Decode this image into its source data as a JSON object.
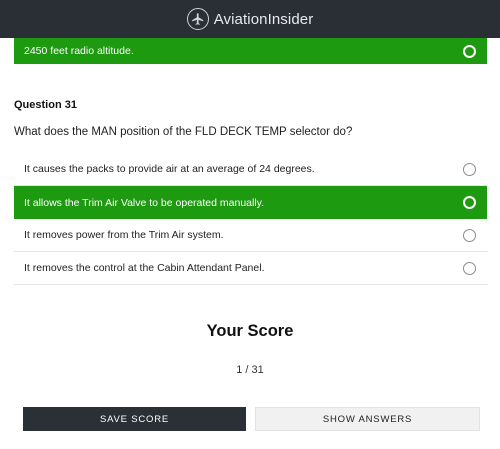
{
  "header": {
    "brand": "AviationInsider",
    "logo_icon": "airplane-icon",
    "background": "#2a2e35"
  },
  "previous_answer": {
    "text": "2450 feet radio altitude.",
    "selected": true
  },
  "question": {
    "number_label": "Question 31",
    "text": "What does the MAN position of the FLD DECK TEMP selector do?",
    "answers": [
      {
        "text": "It causes the packs to provide air at an average of 24 degrees.",
        "selected": false
      },
      {
        "text": "It allows the Trim Air Valve to be operated manually.",
        "selected": true
      },
      {
        "text": "It removes power from the Trim Air system.",
        "selected": false
      },
      {
        "text": "It removes the control at the Cabin Attendant Panel.",
        "selected": false
      }
    ]
  },
  "score": {
    "title": "Your Score",
    "value": "1 / 31"
  },
  "buttons": {
    "save": "SAVE SCORE",
    "show": "SHOW ANSWERS"
  },
  "colors": {
    "selected": "#1e9a10",
    "dark": "#2b2f36"
  }
}
